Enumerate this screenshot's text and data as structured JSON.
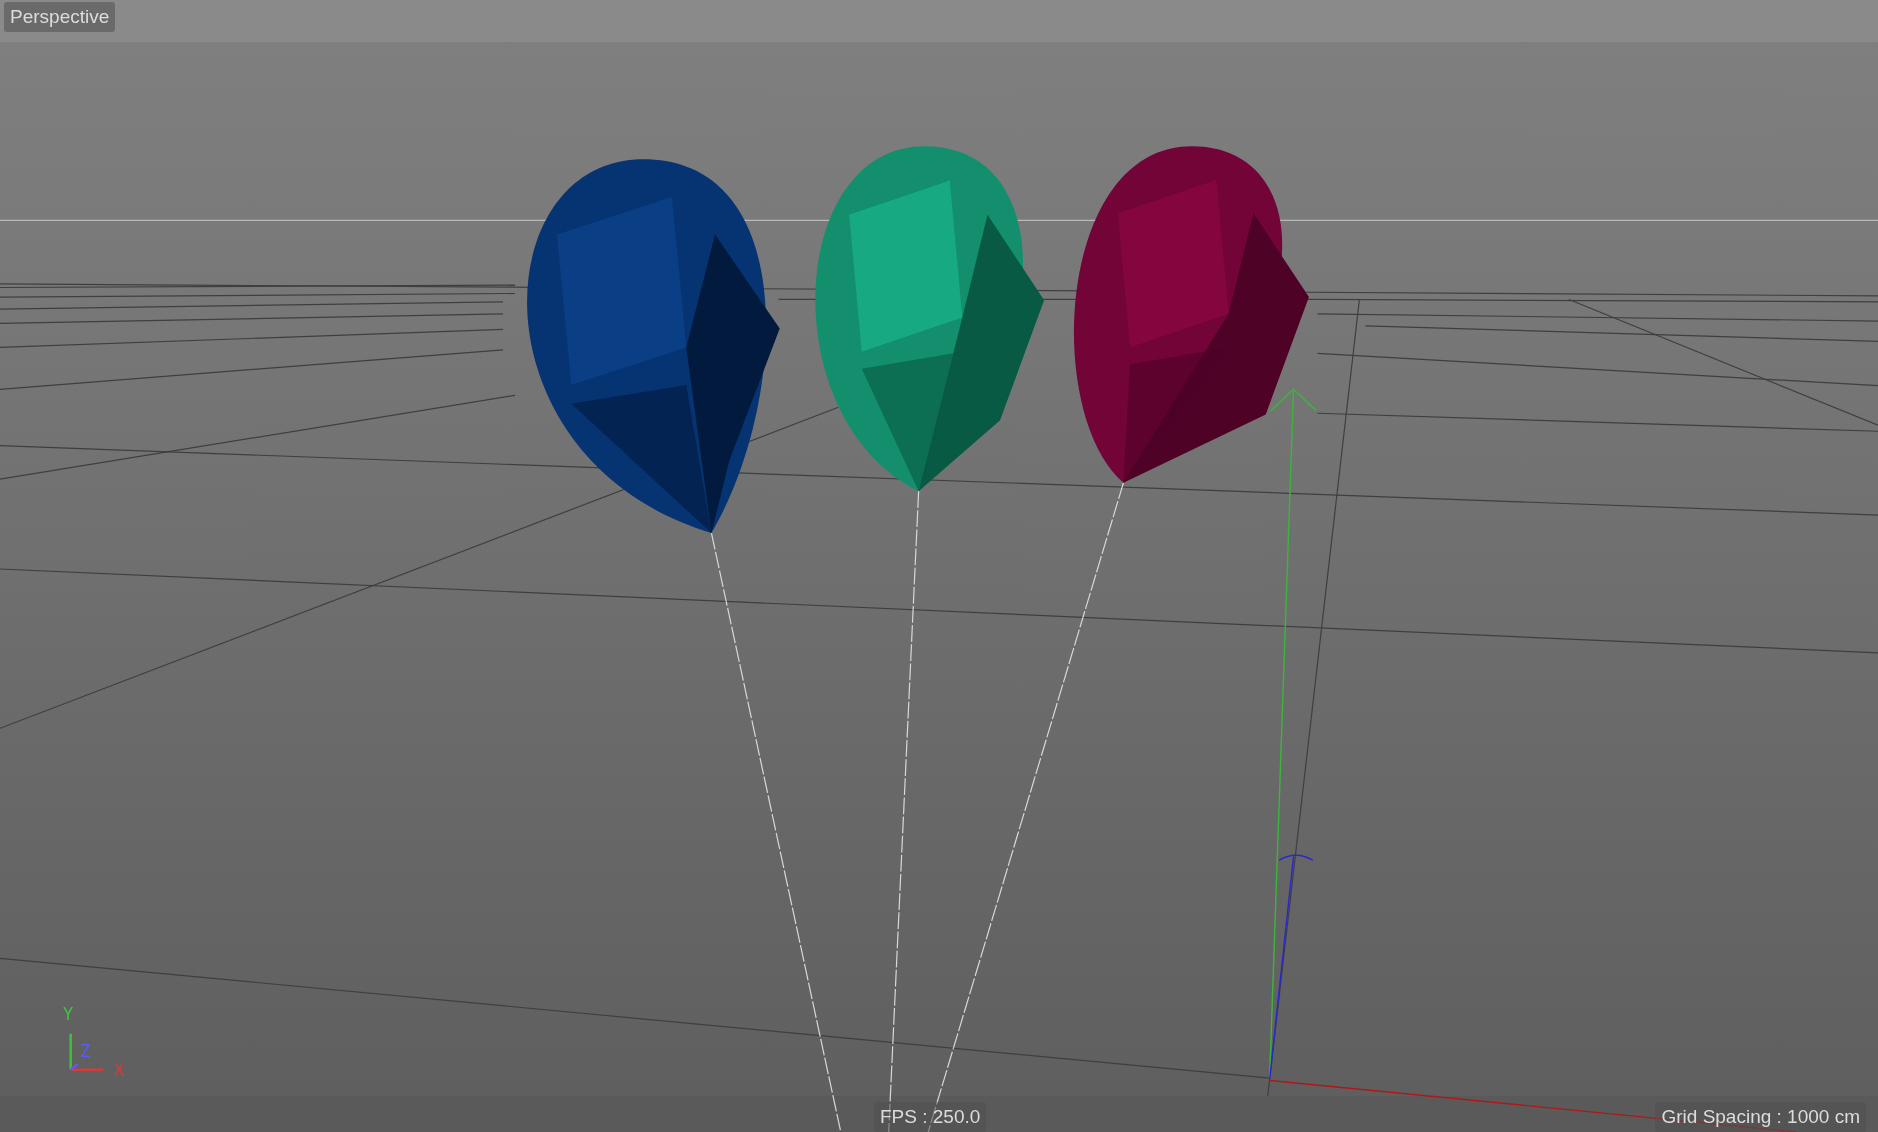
{
  "viewport": {
    "label": "Perspective",
    "fps": "FPS : 250.0",
    "grid_spacing": "Grid Spacing : 1000 cm",
    "axes": [
      {
        "label": "Y",
        "color": "#3fc23f"
      },
      {
        "label": "Z",
        "color": "#5a5aff"
      },
      {
        "label": "X",
        "color": "#d23c3c"
      }
    ]
  }
}
